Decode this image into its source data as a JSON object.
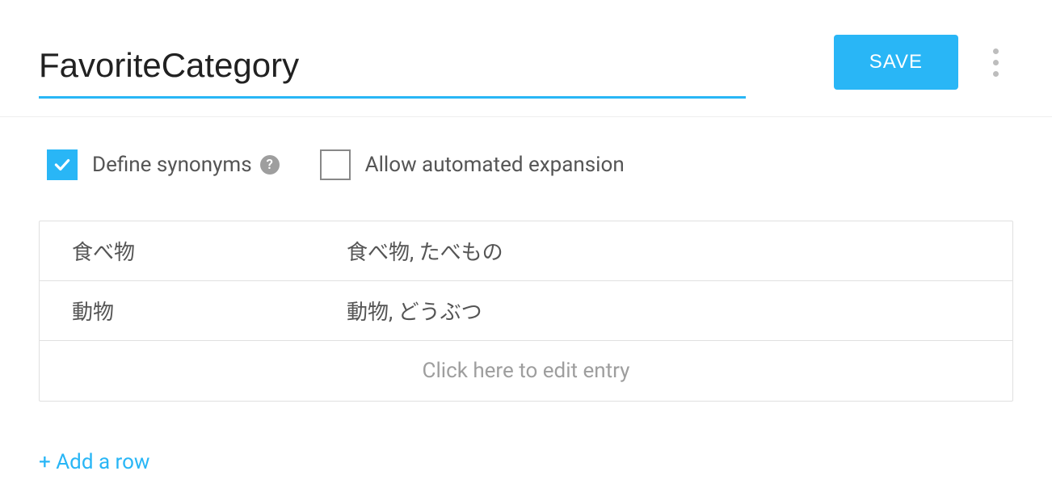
{
  "header": {
    "title": "FavoriteCategory",
    "save_label": "SAVE"
  },
  "options": {
    "define_synonyms": {
      "label": "Define synonyms",
      "checked": true
    },
    "allow_expansion": {
      "label": "Allow automated expansion",
      "checked": false
    }
  },
  "table": {
    "rows": [
      {
        "reference": "食べ物",
        "synonyms": "食べ物, たべもの"
      },
      {
        "reference": "動物",
        "synonyms": "動物, どうぶつ"
      }
    ],
    "placeholder": "Click here to edit entry"
  },
  "add_row_label": "+ Add a row"
}
